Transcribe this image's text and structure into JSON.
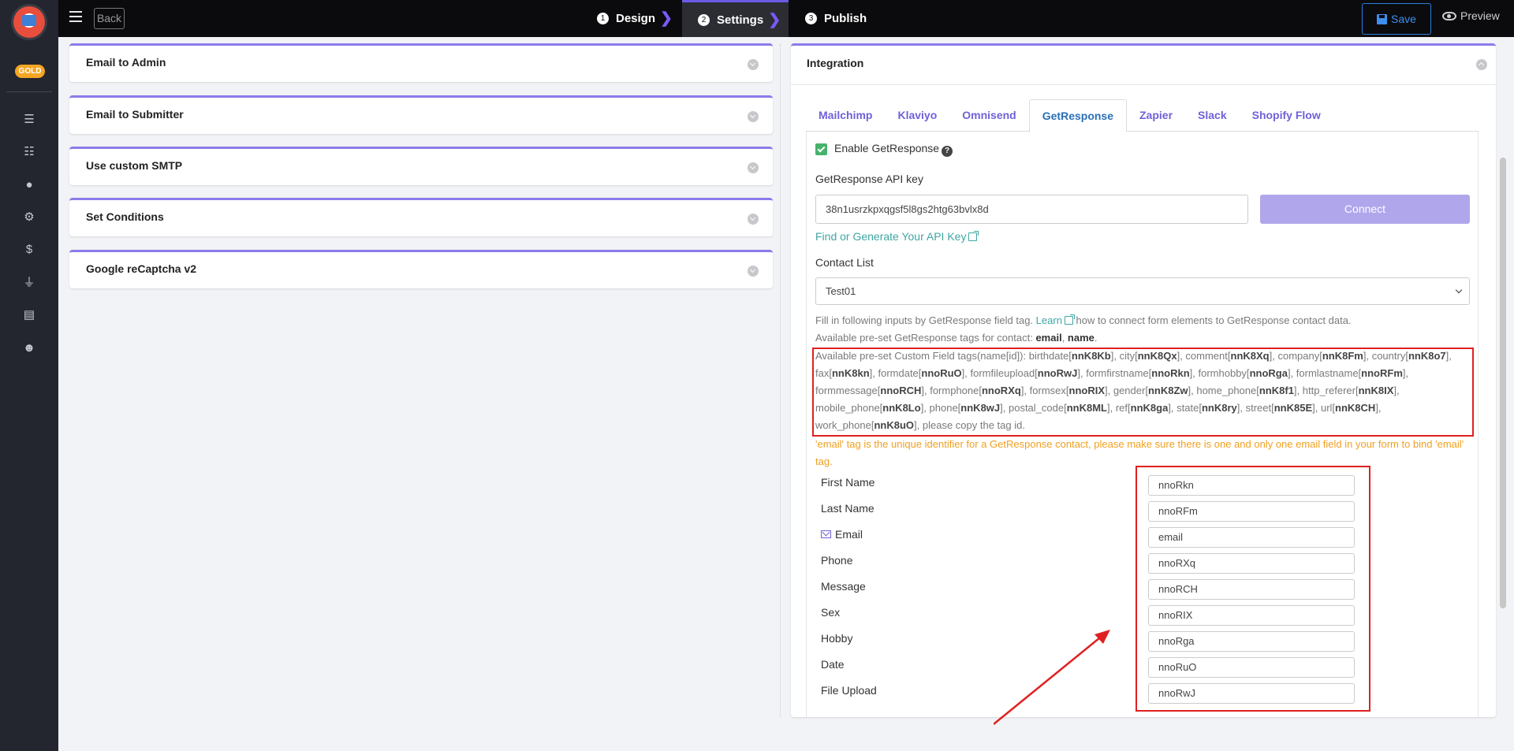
{
  "sidebar": {
    "badge": "GOLD"
  },
  "topbar": {
    "back_label": "Back",
    "steps": [
      {
        "num": "1",
        "label": "Design"
      },
      {
        "num": "2",
        "label": "Settings"
      },
      {
        "num": "3",
        "label": "Publish"
      }
    ],
    "save_label": "Save",
    "preview_label": "Preview"
  },
  "accordions": [
    "Email to Admin",
    "Email to Submitter",
    "Use custom SMTP",
    "Set Conditions",
    "Google reCaptcha v2"
  ],
  "integration": {
    "title": "Integration",
    "tabs": [
      "Mailchimp",
      "Klaviyo",
      "Omnisend",
      "GetResponse",
      "Zapier",
      "Slack",
      "Shopify Flow"
    ],
    "enable_label": "Enable GetResponse",
    "api_key_label": "GetResponse API key",
    "api_key_value": "38n1usrzkpxqgsf5l8gs2htg63bvlx8d",
    "connect_label": "Connect",
    "find_key_link": "Find or Generate Your API Key",
    "contact_list_label": "Contact List",
    "contact_list_value": "Test01",
    "fill_text_pre": "Fill in following inputs by GetResponse field tag.",
    "learn_link": "Learn",
    "fill_text_post": "how to connect form elements to GetResponse contact data.",
    "preset_prefix": "Available pre-set GetResponse tags for contact:",
    "preset_email": "email",
    "preset_name": "name",
    "custom_prefix": "Available pre-set Custom Field tags(name[id]):",
    "custom_fields": [
      [
        "birthdate",
        "nnK8Kb"
      ],
      [
        "city",
        "nnK8Qx"
      ],
      [
        "comment",
        "nnK8Xq"
      ],
      [
        "company",
        "nnK8Fm"
      ],
      [
        "country",
        "nnK8o7"
      ],
      [
        "fax",
        "nnK8kn"
      ],
      [
        "formdate",
        "nnoRuO"
      ],
      [
        "formfileupload",
        "nnoRwJ"
      ],
      [
        "formfirstname",
        "nnoRkn"
      ],
      [
        "formhobby",
        "nnoRga"
      ],
      [
        "formlastname",
        "nnoRFm"
      ],
      [
        "formmessage",
        "nnoRCH"
      ],
      [
        "formphone",
        "nnoRXq"
      ],
      [
        "formsex",
        "nnoRIX"
      ],
      [
        "gender",
        "nnK8Zw"
      ],
      [
        "home_phone",
        "nnK8f1"
      ],
      [
        "http_referer",
        "nnK8IX"
      ],
      [
        "mobile_phone",
        "nnK8Lo"
      ],
      [
        "phone",
        "nnK8wJ"
      ],
      [
        "postal_code",
        "nnK8ML"
      ],
      [
        "ref",
        "nnK8ga"
      ],
      [
        "state",
        "nnK8ry"
      ],
      [
        "street",
        "nnK85E"
      ],
      [
        "url",
        "nnK8CH"
      ],
      [
        "work_phone",
        "nnK8uO"
      ]
    ],
    "custom_suffix": "please copy the tag id.",
    "warning": "'email' tag is the unique identifier for a GetResponse contact, please make sure there is one and only one email field in your form to bind 'email' tag.",
    "mappings": [
      {
        "label": "First Name",
        "value": "nnoRkn"
      },
      {
        "label": "Last Name",
        "value": "nnoRFm"
      },
      {
        "label": "Email",
        "value": "email"
      },
      {
        "label": "Phone",
        "value": "nnoRXq"
      },
      {
        "label": "Message",
        "value": "nnoRCH"
      },
      {
        "label": "Sex",
        "value": "nnoRIX"
      },
      {
        "label": "Hobby",
        "value": "nnoRga"
      },
      {
        "label": "Date",
        "value": "nnoRuO"
      },
      {
        "label": "File Upload",
        "value": "nnoRwJ"
      }
    ]
  },
  "colors": {
    "accent": "#8b7bea",
    "topbar": "#0b0b0d",
    "sidebar": "#23262f",
    "link": "#3fa6a3",
    "warning": "#f0a020",
    "annotation": "#e02020"
  }
}
